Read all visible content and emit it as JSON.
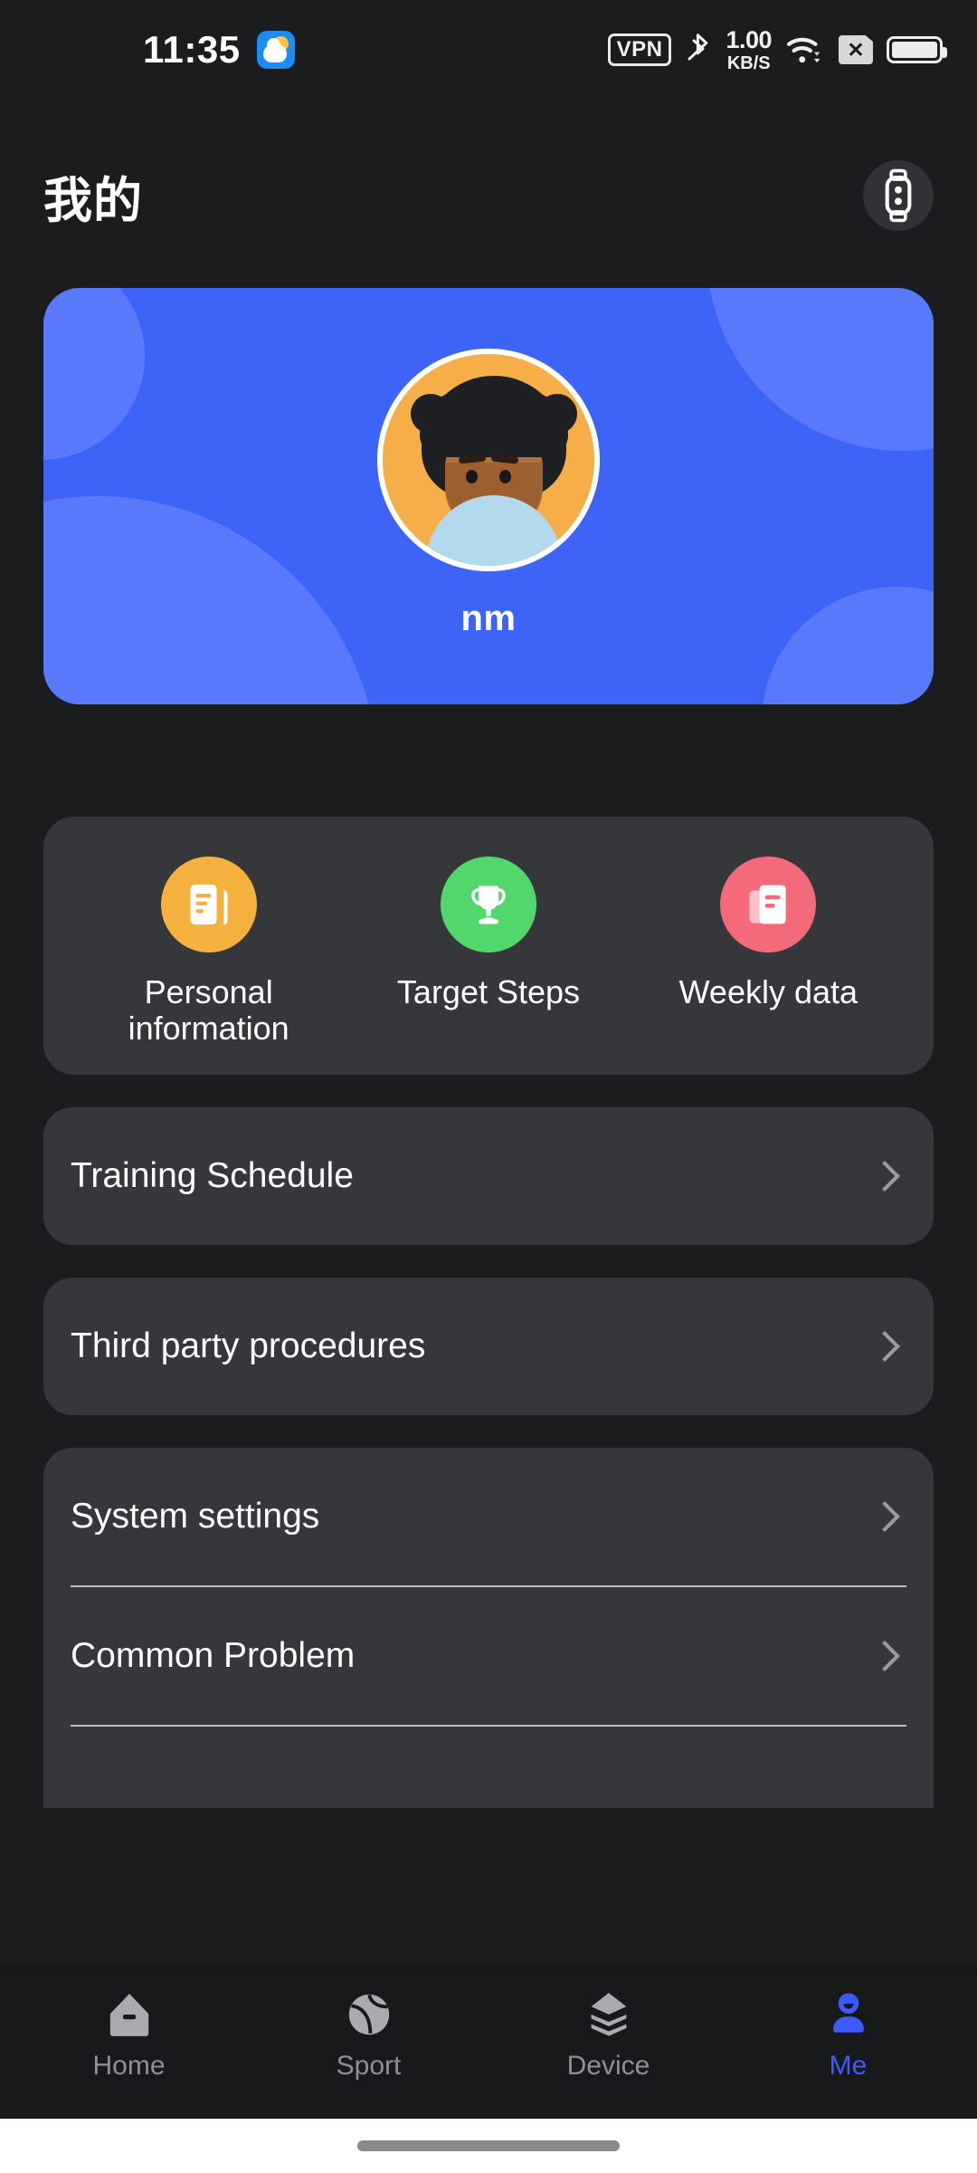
{
  "status_bar": {
    "time": "11:35",
    "weather_icon": "partly-cloudy-icon",
    "vpn_label": "VPN",
    "bluetooth_icon": "bluetooth-icon",
    "net_speed_value": "1.00",
    "net_speed_unit": "KB/S",
    "wifi_icon": "wifi-icon",
    "sim_icon": "sim-card-disabled-icon",
    "battery_icon": "battery-full-icon"
  },
  "header": {
    "title": "我的",
    "band_button_icon": "fitness-band-icon"
  },
  "profile": {
    "name": "nm",
    "avatar_icon": "user-avatar-illustration",
    "card_color": "#3d63f7"
  },
  "quick_actions": [
    {
      "label": "Personal information",
      "icon": "document-pencil-icon",
      "color": "#f5b13d"
    },
    {
      "label": "Target Steps",
      "icon": "trophy-icon",
      "color": "#52d76c"
    },
    {
      "label": "Weekly data",
      "icon": "documents-stack-icon",
      "color": "#f56a7b"
    }
  ],
  "menu_cards": [
    {
      "label": "Training Schedule",
      "chevron": "chevron-right-icon"
    },
    {
      "label": "Third party procedures",
      "chevron": "chevron-right-icon"
    }
  ],
  "settings_items": [
    {
      "label": "System settings",
      "chevron": "chevron-right-icon"
    },
    {
      "label": "Common Problem",
      "chevron": "chevron-right-icon"
    }
  ],
  "bottom_nav": {
    "active_color": "#3d5afe",
    "inactive_color": "#8d9095",
    "items": [
      {
        "label": "Home",
        "icon": "home-icon",
        "active": false
      },
      {
        "label": "Sport",
        "icon": "sport-ball-icon",
        "active": false
      },
      {
        "label": "Device",
        "icon": "layers-icon",
        "active": false
      },
      {
        "label": "Me",
        "icon": "person-icon",
        "active": true
      }
    ]
  }
}
